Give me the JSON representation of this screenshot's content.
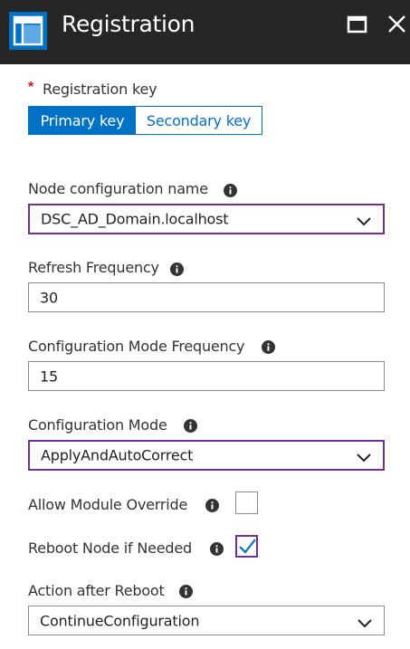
{
  "header": {
    "title": "Registration",
    "app_icon": "blade-layout-icon",
    "maximize_icon": "maximize-icon",
    "close_icon": "close-icon",
    "background": "#262626",
    "icon_accent": "#0072c6"
  },
  "registration_key": {
    "label": "Registration key",
    "required_marker": "*",
    "options": [
      "Primary key",
      "Secondary key"
    ],
    "selected": "Primary key"
  },
  "node_configuration": {
    "label": "Node configuration name",
    "value": "DSC_AD_Domain.localhost"
  },
  "refresh_frequency": {
    "label": "Refresh Frequency",
    "value": "30"
  },
  "configuration_mode_frequency": {
    "label": "Configuration Mode Frequency",
    "value": "15"
  },
  "configuration_mode": {
    "label": "Configuration Mode",
    "value": "ApplyAndAutoCorrect"
  },
  "allow_module_override": {
    "label": "Allow Module Override",
    "checked": false
  },
  "reboot_node": {
    "label": "Reboot Node if Needed",
    "checked": true
  },
  "action_after_reboot": {
    "label": "Action after Reboot",
    "value": "ContinueConfiguration"
  },
  "colors": {
    "accent": "#0072c6",
    "focus_border": "#7b2c9b",
    "required": "#e81123"
  }
}
